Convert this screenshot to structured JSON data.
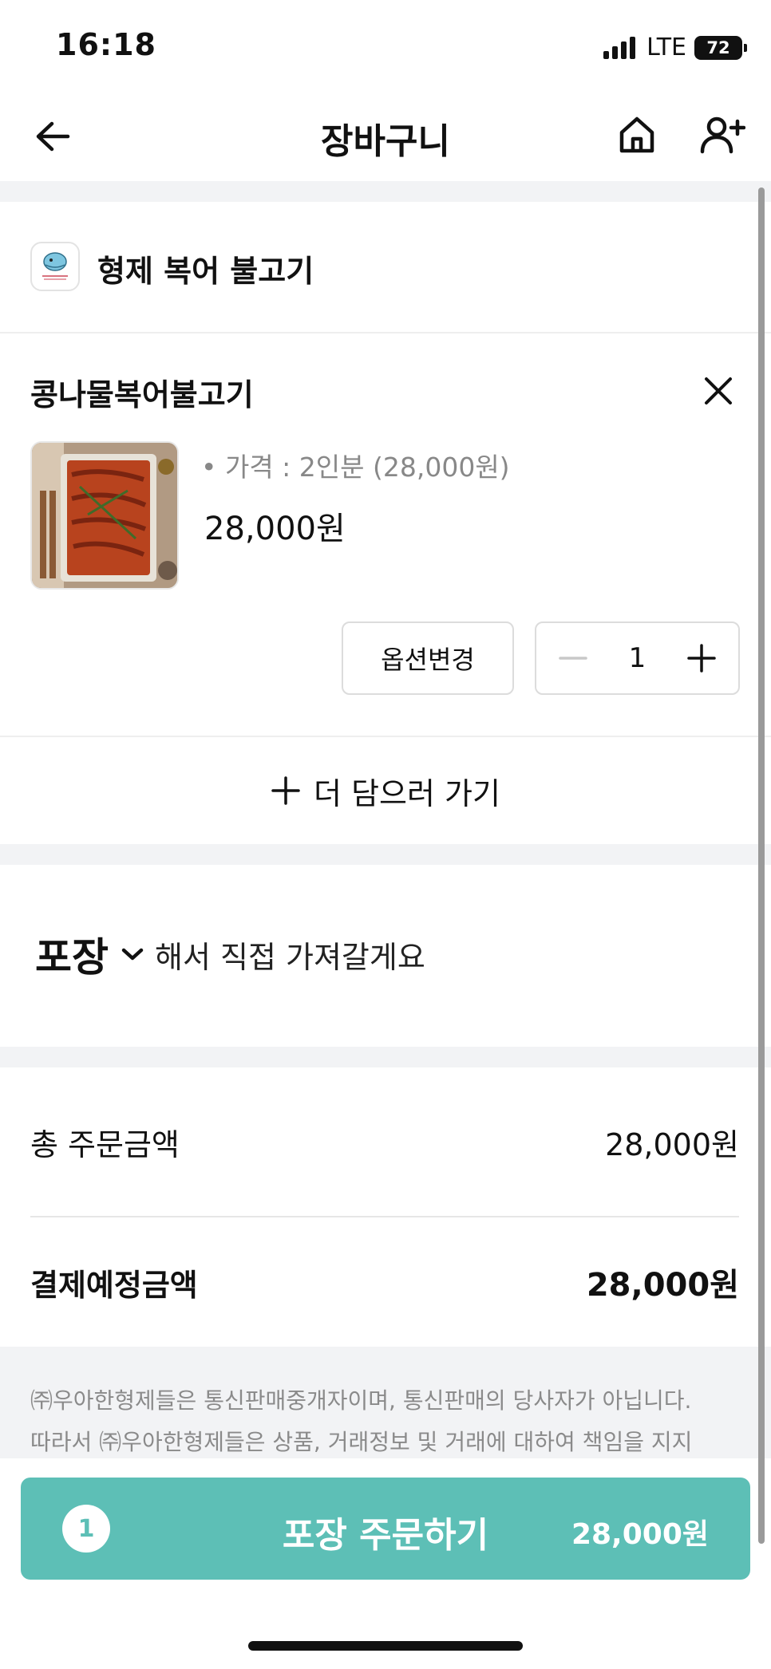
{
  "status_bar": {
    "time": "16:18",
    "network": "LTE",
    "battery": "72"
  },
  "header": {
    "title": "장바구니",
    "back_icon": "arrow-left-icon",
    "home_icon": "home-icon",
    "add_user_icon": "person-add-icon"
  },
  "store": {
    "name": "형제 복어 불고기"
  },
  "cart_item": {
    "name": "콩나물복어불고기",
    "option": "• 가격 : 2인분 (28,000원)",
    "price": "28,000원",
    "option_change_label": "옵션변경",
    "quantity": "1"
  },
  "add_more": {
    "label": "더 담으러 가기"
  },
  "packaging": {
    "type": "포장",
    "description": "해서 직접 가져갈게요"
  },
  "summary": {
    "total_label": "총 주문금액",
    "total_value": "28,000원",
    "payment_label": "결제예정금액",
    "payment_value": "28,000원"
  },
  "notice": {
    "line1": "㈜우아한형제들은 통신판매중개자이며, 통신판매의 당사자가 아닙니다.",
    "line2": "따라서 ㈜우아한형제들은 상품, 거래정보 및 거래에 대하여 책임을 지지"
  },
  "order_button": {
    "count": "1",
    "label": "포장 주문하기",
    "price": "28,000원"
  },
  "colors": {
    "accent": "#5dbfb6",
    "section_gray": "#f2f3f5"
  }
}
